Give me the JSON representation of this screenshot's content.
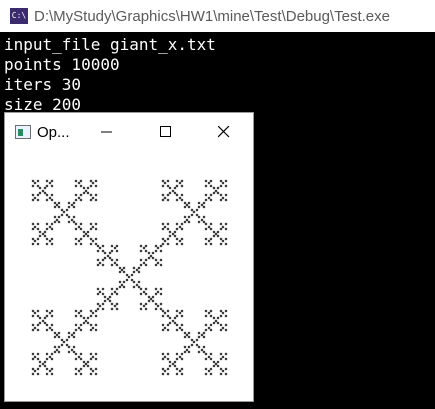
{
  "console": {
    "title": "D:\\MyStudy\\Graphics\\HW1\\mine\\Test\\Debug\\Test.exe",
    "icon": "console-app-icon",
    "icon_text": "C:\\",
    "lines": [
      "input_file giant_x.txt",
      "points 10000",
      "iters 30",
      "size 200"
    ]
  },
  "gl_window": {
    "title": "Op...",
    "icon": "window-app-icon",
    "minimize_icon": "minimize-icon",
    "maximize_icon": "maximize-icon",
    "close_icon": "close-icon"
  },
  "colors": {
    "fractal": "#000000",
    "console_bg": "#000000",
    "console_text": "#ffffff"
  }
}
